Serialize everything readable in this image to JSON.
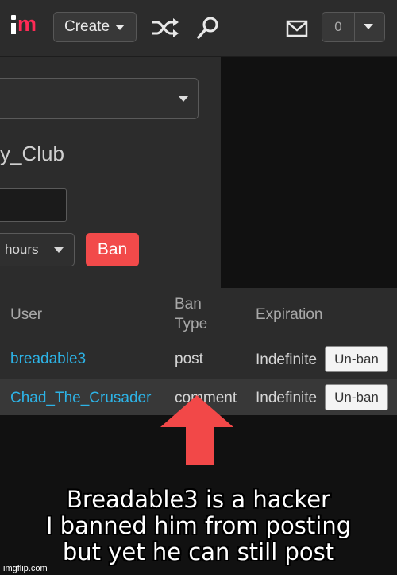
{
  "topbar": {
    "logo_text": "im",
    "create_label": "Create",
    "icons": [
      "shuffle-icon",
      "search-icon",
      "mail-icon",
      "chevron-down-icon"
    ],
    "notification_count": "0"
  },
  "form": {
    "stream_select_value": "",
    "club_name": "y_Club",
    "username_input_value": "",
    "duration_value": "hours",
    "ban_label": "Ban"
  },
  "table": {
    "headers": {
      "user": "User",
      "ban_type_line1": "Ban",
      "ban_type_line2": "Type",
      "expiration": "Expiration"
    },
    "rows": [
      {
        "user": "breadable3",
        "ban_type": "post",
        "expiration": "Indefinite",
        "action": "Un-ban"
      },
      {
        "user": "Chad_The_Crusader",
        "ban_type": "comment",
        "expiration": "Indefinite",
        "action": "Un-ban"
      }
    ]
  },
  "caption": {
    "line1": "Breadable3 is a hacker",
    "line2": "I banned him from posting",
    "line3": "but yet he can still post"
  },
  "watermark": "imgflip.com",
  "colors": {
    "background": "#111111",
    "panel": "#2c2c2c",
    "accent_red": "#f24a4a",
    "logo_red": "#ff2a55",
    "link_blue": "#2db3e6",
    "arrow_red": "#f24848"
  }
}
